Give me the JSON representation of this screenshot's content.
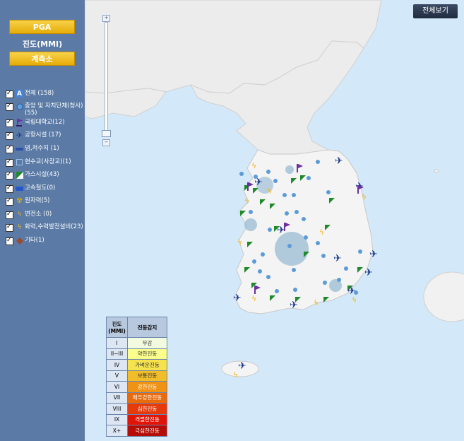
{
  "sidebar": {
    "pga_label": "PGA",
    "mmi_label": "진도(MMI)",
    "station_label": "계측소",
    "layers": [
      {
        "icon": "all-icon",
        "label": "전체 (158)"
      },
      {
        "icon": "government-icon",
        "label": "중앙 및 자치단체(청사) (55)"
      },
      {
        "icon": "university-icon",
        "label": "국립대학교(12)"
      },
      {
        "icon": "airplane-icon",
        "label": "공항시설 (17)"
      },
      {
        "icon": "dam-icon",
        "label": "댐,저수지 (1)"
      },
      {
        "icon": "bridge-icon",
        "label": "현수교(사장교)(1)"
      },
      {
        "icon": "gas-icon",
        "label": "가스시설(43)"
      },
      {
        "icon": "railway-icon",
        "label": "고속철도(0)"
      },
      {
        "icon": "nuclear-icon",
        "label": "원자력(5)"
      },
      {
        "icon": "substation-icon",
        "label": "변전소 (0)"
      },
      {
        "icon": "power-plant-icon",
        "label": "화력,수력발전설비(23)"
      },
      {
        "icon": "other-icon",
        "label": "기타(1)"
      }
    ]
  },
  "map": {
    "full_view_label": "전체보기",
    "zoom_plus": "+",
    "zoom_minus": "−"
  },
  "legend": {
    "header_intensity": "진도\n(MMI)",
    "header_feel": "진동감지",
    "rows": [
      {
        "mmi": "I",
        "feel": "무감",
        "color": "#f2fbe0"
      },
      {
        "mmi": "II~III",
        "feel": "약한진동",
        "color": "#fbff8c"
      },
      {
        "mmi": "IV",
        "feel": "가벼운진동",
        "color": "#f5e24d"
      },
      {
        "mmi": "V",
        "feel": "보통진동",
        "color": "#f1be2a"
      },
      {
        "mmi": "VI",
        "feel": "강한진동",
        "color": "#f09213"
      },
      {
        "mmi": "VII",
        "feel": "매우강한진동",
        "color": "#ea6b0c"
      },
      {
        "mmi": "VIII",
        "feel": "심한진동",
        "color": "#e73a0b"
      },
      {
        "mmi": "IX",
        "feel": "격렬한진동",
        "color": "#e01508"
      },
      {
        "mmi": "X+",
        "feel": "극심한진동",
        "color": "#b50d06"
      }
    ]
  }
}
